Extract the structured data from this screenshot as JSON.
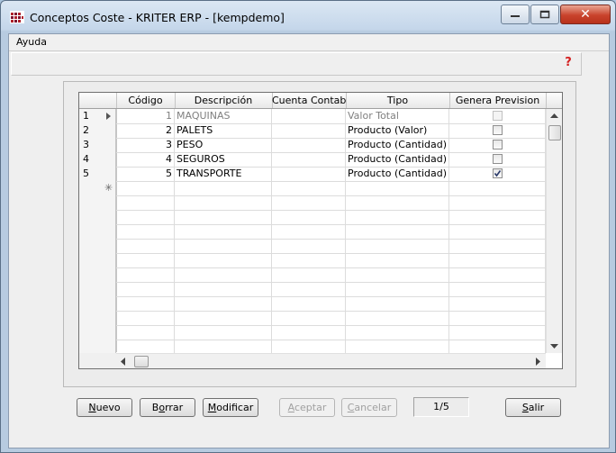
{
  "window": {
    "title": "Conceptos Coste - KRITER ERP - [kempdemo]",
    "close_glyph": "✕",
    "accent": "#c9432c"
  },
  "menu": {
    "items": [
      {
        "label": "Ayuda"
      }
    ]
  },
  "help_icon": {
    "glyph": "?",
    "icon": "help-icon"
  },
  "grid": {
    "columns": [
      "Código",
      "Descripción",
      "Cuenta Contable",
      "Tipo",
      "Genera Prevision"
    ],
    "rows": [
      {
        "num": "1",
        "codigo": "1",
        "descripcion": "MAQUINAS",
        "cuenta": "",
        "tipo": "Valor Total",
        "genera": false,
        "current": true
      },
      {
        "num": "2",
        "codigo": "2",
        "descripcion": "PALETS",
        "cuenta": "",
        "tipo": "Producto (Valor)",
        "genera": false
      },
      {
        "num": "3",
        "codigo": "3",
        "descripcion": "PESO",
        "cuenta": "",
        "tipo": "Producto (Cantidad)",
        "genera": false
      },
      {
        "num": "4",
        "codigo": "4",
        "descripcion": "SEGUROS",
        "cuenta": "",
        "tipo": "Producto (Cantidad)",
        "genera": false
      },
      {
        "num": "5",
        "codigo": "5",
        "descripcion": "TRANSPORTE",
        "cuenta": "",
        "tipo": "Producto (Cantidad)",
        "genera": true
      }
    ],
    "new_row_marker": "✳"
  },
  "buttons": {
    "nuevo": {
      "pre": "",
      "u": "N",
      "post": "uevo"
    },
    "borrar": {
      "pre": "B",
      "u": "o",
      "post": "rrar"
    },
    "modificar": {
      "pre": "",
      "u": "M",
      "post": "odificar"
    },
    "aceptar": {
      "pre": "",
      "u": "A",
      "post": "ceptar"
    },
    "cancelar": {
      "pre": "",
      "u": "C",
      "post": "ancelar"
    },
    "salir": {
      "pre": "",
      "u": "S",
      "post": "alir"
    }
  },
  "record_counter": "1/5"
}
